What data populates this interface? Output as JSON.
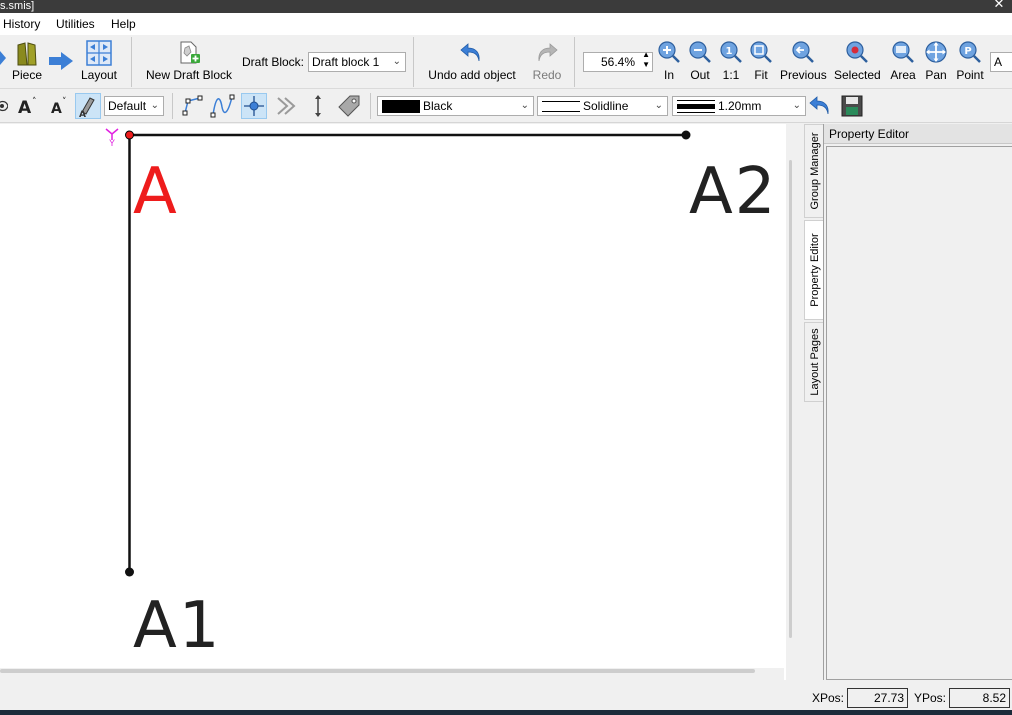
{
  "window": {
    "title": "s.smis]",
    "close_glyph": "✕"
  },
  "menu": {
    "items": [
      "History",
      "Utilities",
      "Help"
    ]
  },
  "toolbar1": {
    "piece_label": "Piece",
    "layout_label": "Layout",
    "new_draft_block_label": "New Draft Block",
    "draft_block_label": "Draft Block:",
    "draft_block_value": "Draft block 1",
    "undo_label": "Undo add object",
    "redo_label": "Redo",
    "zoom_value": "56.4%",
    "zoom_in_label": "In",
    "zoom_out_label": "Out",
    "zoom_1to1_label": "1:1",
    "zoom_fit_label": "Fit",
    "zoom_previous_label": "Previous",
    "zoom_selected_label": "Selected",
    "zoom_area_label": "Area",
    "pan_label": "Pan",
    "point_label": "Point",
    "point_combo_value": "A"
  },
  "toolbar2": {
    "text_style_value": "Default",
    "color_value": "Black",
    "line_type_value": "Solidline",
    "line_weight_value": "1.20mm"
  },
  "canvas": {
    "origin_y_label": "Y",
    "points": [
      {
        "name": "A",
        "color": "#ee1c1c"
      },
      {
        "name": "A2",
        "color": "#222222"
      },
      {
        "name": "A1",
        "color": "#222222"
      }
    ]
  },
  "side_tabs": [
    "Group Manager",
    "Property Editor",
    "Layout Pages"
  ],
  "property_editor": {
    "title": "Property Editor"
  },
  "status": {
    "xpos_label": "XPos:",
    "xpos_value": "27.73",
    "ypos_label": "YPos:",
    "ypos_value": "8.52"
  },
  "colors": {
    "accent": "#3c7fd6",
    "point_selected": "#ee1c1c",
    "line": "#111111",
    "origin_marker": "#e020e0"
  }
}
